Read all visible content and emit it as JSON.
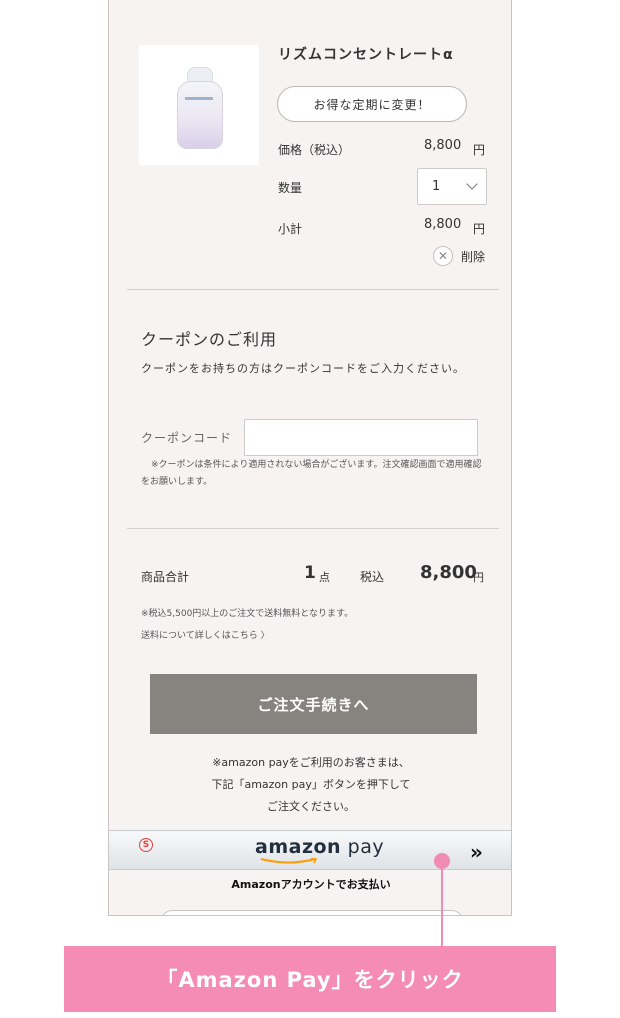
{
  "product": {
    "name": "リズムコンセントレートα",
    "change_button": "お得な定期に変更！",
    "price_label": "価格（税込）",
    "price_value": "8,800",
    "yen": "円",
    "quantity_label": "数量",
    "quantity_value": "1",
    "subtotal_label": "小計",
    "subtotal_value": "8,800",
    "delete_label": "削除"
  },
  "coupon": {
    "title": "クーポンのご利用",
    "description": "クーポンをお持ちの方はクーポンコードをご入力ください。",
    "code_label": "クーポンコード",
    "code_value": "",
    "note": "※クーポンは条件により適用されない場合がございます。注文確認画面で適用確認をお願いします。"
  },
  "summary": {
    "label": "商品合計",
    "quantity": "1",
    "quantity_unit": "点",
    "tax_label": "税込",
    "total": "8,800",
    "total_unit": "円",
    "shipping_note": "※税込5,500円以上のご注文で送料無料となります。",
    "shipping_link": "送料について詳しくはこちら 〉"
  },
  "checkout_button": "ご注文手続きへ",
  "amazon": {
    "note_line1": "※amazon payをご利用のお客さまは、",
    "note_line2": "下記「amazon pay」ボタンを押下して",
    "note_line3": "ご注文ください。",
    "logo_amazon": "amazon",
    "logo_pay": " pay",
    "s_mark": "S",
    "arrows": "»",
    "subtitle": "Amazonアカウントでお支払い"
  },
  "callout": "「Amazon Pay」をクリック",
  "colors": {
    "background": "#f7f3f3",
    "checkout": "#85847e",
    "callout": "#f48cb6"
  }
}
